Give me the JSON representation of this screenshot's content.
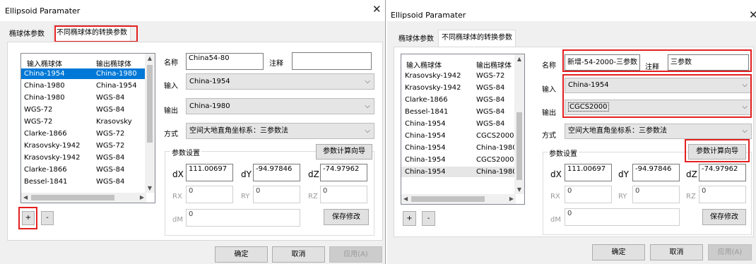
{
  "d1": {
    "title": "Ellipsoid Paramater",
    "tabs": [
      "椭球体参数",
      "不同椭球体的转换参数"
    ],
    "list_head": [
      "输入椭球体",
      "输出椭球体"
    ],
    "rows": [
      [
        "China-1954",
        "China-1980"
      ],
      [
        "China-1980",
        "China-1954"
      ],
      [
        "China-1980",
        "WGS-84"
      ],
      [
        "WGS-72",
        "WGS-84"
      ],
      [
        "WGS-72",
        "Krasovsky"
      ],
      [
        "Clarke-1866",
        "WGS-72"
      ],
      [
        "Krasovsky-1942",
        "WGS-72"
      ],
      [
        "Krasovsky-1942",
        "WGS-84"
      ],
      [
        "Clarke-1866",
        "WGS-84"
      ],
      [
        "Bessel-1841",
        "WGS-84"
      ]
    ],
    "add": "+",
    "remove": "-",
    "name_label": "名称",
    "name": "China54-80",
    "note_label": "注释",
    "note": "",
    "input_label": "输入",
    "input": "China-1954",
    "output_label": "输出",
    "output": "China-1980",
    "method_label": "方式",
    "method": "空间大地直角坐标系：三参数法",
    "params_label": "参数设置",
    "wizard": "参数计算向导",
    "dX_l": "dX",
    "dX": "111.00697",
    "dY_l": "dY",
    "dY": "-94.97846",
    "dZ_l": "dZ",
    "dZ": "-74.97962",
    "RX_l": "RX",
    "RX": "0",
    "RY_l": "RY",
    "RY": "0",
    "RZ_l": "RZ",
    "RZ": "0",
    "dM_l": "dM",
    "dM": "0",
    "save": "保存修改",
    "ok": "确定",
    "cancel": "取消",
    "apply": "应用(A)"
  },
  "d2": {
    "title": "Ellipsoid Paramater",
    "tabs": [
      "椭球体参数",
      "不同椭球体的转换参数"
    ],
    "list_head": [
      "输入椭球体",
      "输出椭球体"
    ],
    "rows": [
      [
        "Krasovsky-1942",
        "WGS-72"
      ],
      [
        "Krasovsky-1942",
        "WGS-84"
      ],
      [
        "Clarke-1866",
        "WGS-84"
      ],
      [
        "Bessel-1841",
        "WGS-84"
      ],
      [
        "China-1954",
        "WGS-84"
      ],
      [
        "China-1954",
        "CGCS2000"
      ],
      [
        "China-1954",
        "China-1980"
      ],
      [
        "China-1954",
        "CGCS2000"
      ],
      [
        "China-1954",
        "China-1980"
      ]
    ],
    "add": "+",
    "remove": "-",
    "name_label": "名称",
    "name": "新增-54-2000-三参数",
    "note_label": "注释",
    "note": "三参数",
    "input_label": "输入",
    "input": "China-1954",
    "output_label": "输出",
    "output": "CGCS2000",
    "method_label": "方式",
    "method": "空间大地直角坐标系：三参数法",
    "params_label": "参数设置",
    "wizard": "参数计算向导",
    "dX_l": "dX",
    "dX": "111.00697",
    "dY_l": "dY",
    "dY": "-94.97846",
    "dZ_l": "dZ",
    "dZ": "-74.97962",
    "RX_l": "RX",
    "RX": "0",
    "RY_l": "RY",
    "RY": "0",
    "RZ_l": "RZ",
    "RZ": "0",
    "dM_l": "dM",
    "dM": "0",
    "save": "保存修改",
    "ok": "确定",
    "cancel": "取消",
    "apply": "应用(A)"
  },
  "close_glyph": "✕",
  "highlight_color": "#e32020",
  "selection_color": "#0078d7"
}
